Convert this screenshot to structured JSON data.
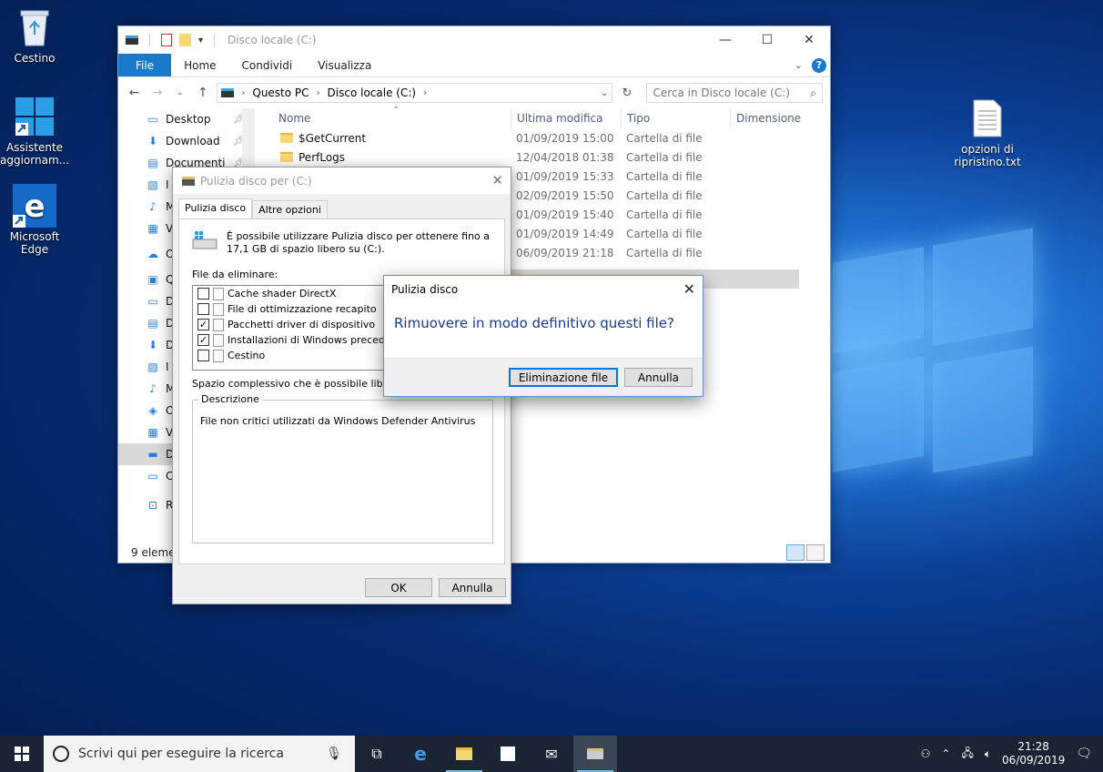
{
  "desktop": {
    "icons": [
      {
        "label": "Cestino",
        "icon": "recycle-bin-icon"
      },
      {
        "label": "Assistente aggiornam...",
        "icon": "windows-update-assistant-icon"
      },
      {
        "label": "Microsoft Edge",
        "icon": "edge-icon"
      },
      {
        "label": "opzioni di ripristino.txt",
        "icon": "text-file-icon"
      }
    ]
  },
  "explorer": {
    "title": "Disco locale (C:)",
    "ribbon_tabs": [
      "File",
      "Home",
      "Condividi",
      "Visualizza"
    ],
    "address": [
      "Questo PC",
      "Disco locale (C:)"
    ],
    "search_placeholder": "Cerca in Disco locale (C:)",
    "nav": [
      {
        "label": "Desktop",
        "icon": "desktop-icon",
        "pinned": true
      },
      {
        "label": "Download",
        "icon": "download-icon",
        "pinned": true
      },
      {
        "label": "Documenti",
        "icon": "documents-icon",
        "pinned": true
      },
      {
        "label": "I",
        "icon": "pictures-icon"
      },
      {
        "label": "M",
        "icon": "music-icon"
      },
      {
        "label": "V",
        "icon": "videos-icon"
      },
      {
        "label": "On",
        "icon": "onedrive-icon"
      },
      {
        "label": "Qu",
        "icon": "this-pc-icon"
      },
      {
        "label": "D",
        "icon": "desktop-icon"
      },
      {
        "label": "D",
        "icon": "documents-icon"
      },
      {
        "label": "D",
        "icon": "download-icon"
      },
      {
        "label": "I",
        "icon": "pictures-icon"
      },
      {
        "label": "M",
        "icon": "music-icon"
      },
      {
        "label": "O",
        "icon": "3d-objects-icon"
      },
      {
        "label": "V",
        "icon": "videos-icon"
      },
      {
        "label": "D",
        "icon": "drive-icon",
        "selected": true
      },
      {
        "label": "C",
        "icon": "network-drive-icon"
      },
      {
        "label": "Ret",
        "icon": "network-icon"
      }
    ],
    "columns": [
      "Nome",
      "Ultima modifica",
      "Tipo",
      "Dimensione"
    ],
    "rows": [
      {
        "name": "$GetCurrent",
        "date": "01/09/2019 15:00",
        "type": "Cartella di file"
      },
      {
        "name": "PerfLogs",
        "date": "12/04/2018 01:38",
        "type": "Cartella di file"
      },
      {
        "name": "",
        "date": "01/09/2019 15:33",
        "type": "Cartella di file"
      },
      {
        "name": "",
        "date": "02/09/2019 15:50",
        "type": "Cartella di file"
      },
      {
        "name": "",
        "date": "01/09/2019 15:40",
        "type": "Cartella di file"
      },
      {
        "name": "",
        "date": "01/09/2019 14:49",
        "type": "Cartella di file"
      },
      {
        "name": "",
        "date": "06/09/2019 21:18",
        "type": "Cartella di file"
      }
    ],
    "status": "9 elemen"
  },
  "cleanup": {
    "title": "Pulizia disco per  (C:)",
    "tabs": [
      "Pulizia disco",
      "Altre opzioni"
    ],
    "intro": "È possibile utilizzare Pulizia disco per ottenere fino a 17,1 GB di spazio libero su  (C:).",
    "files_label": "File da eliminare:",
    "items": [
      {
        "label": "Cache shader DirectX",
        "checked": false
      },
      {
        "label": "File di ottimizzazione recapito",
        "checked": false
      },
      {
        "label": "Pacchetti driver di dispositivo",
        "checked": true
      },
      {
        "label": "Installazioni di Windows precedenti",
        "checked": true
      },
      {
        "label": "Cestino",
        "checked": false
      }
    ],
    "space_label": "Spazio complessivo che è possibile liberare:",
    "desc_legend": "Descrizione",
    "desc_text": "File non critici utilizzati da Windows Defender Antivirus",
    "ok": "OK",
    "cancel": "Annulla"
  },
  "confirm": {
    "title": "Pulizia disco",
    "message": "Rimuovere in modo definitivo questi file?",
    "delete": "Eliminazione file",
    "cancel": "Annulla"
  },
  "taskbar": {
    "search_placeholder": "Scrivi qui per eseguire la ricerca",
    "time": "21:28",
    "date": "06/09/2019"
  },
  "colors": {
    "accent": "#1979ca",
    "taskbar": "#1a2433"
  }
}
